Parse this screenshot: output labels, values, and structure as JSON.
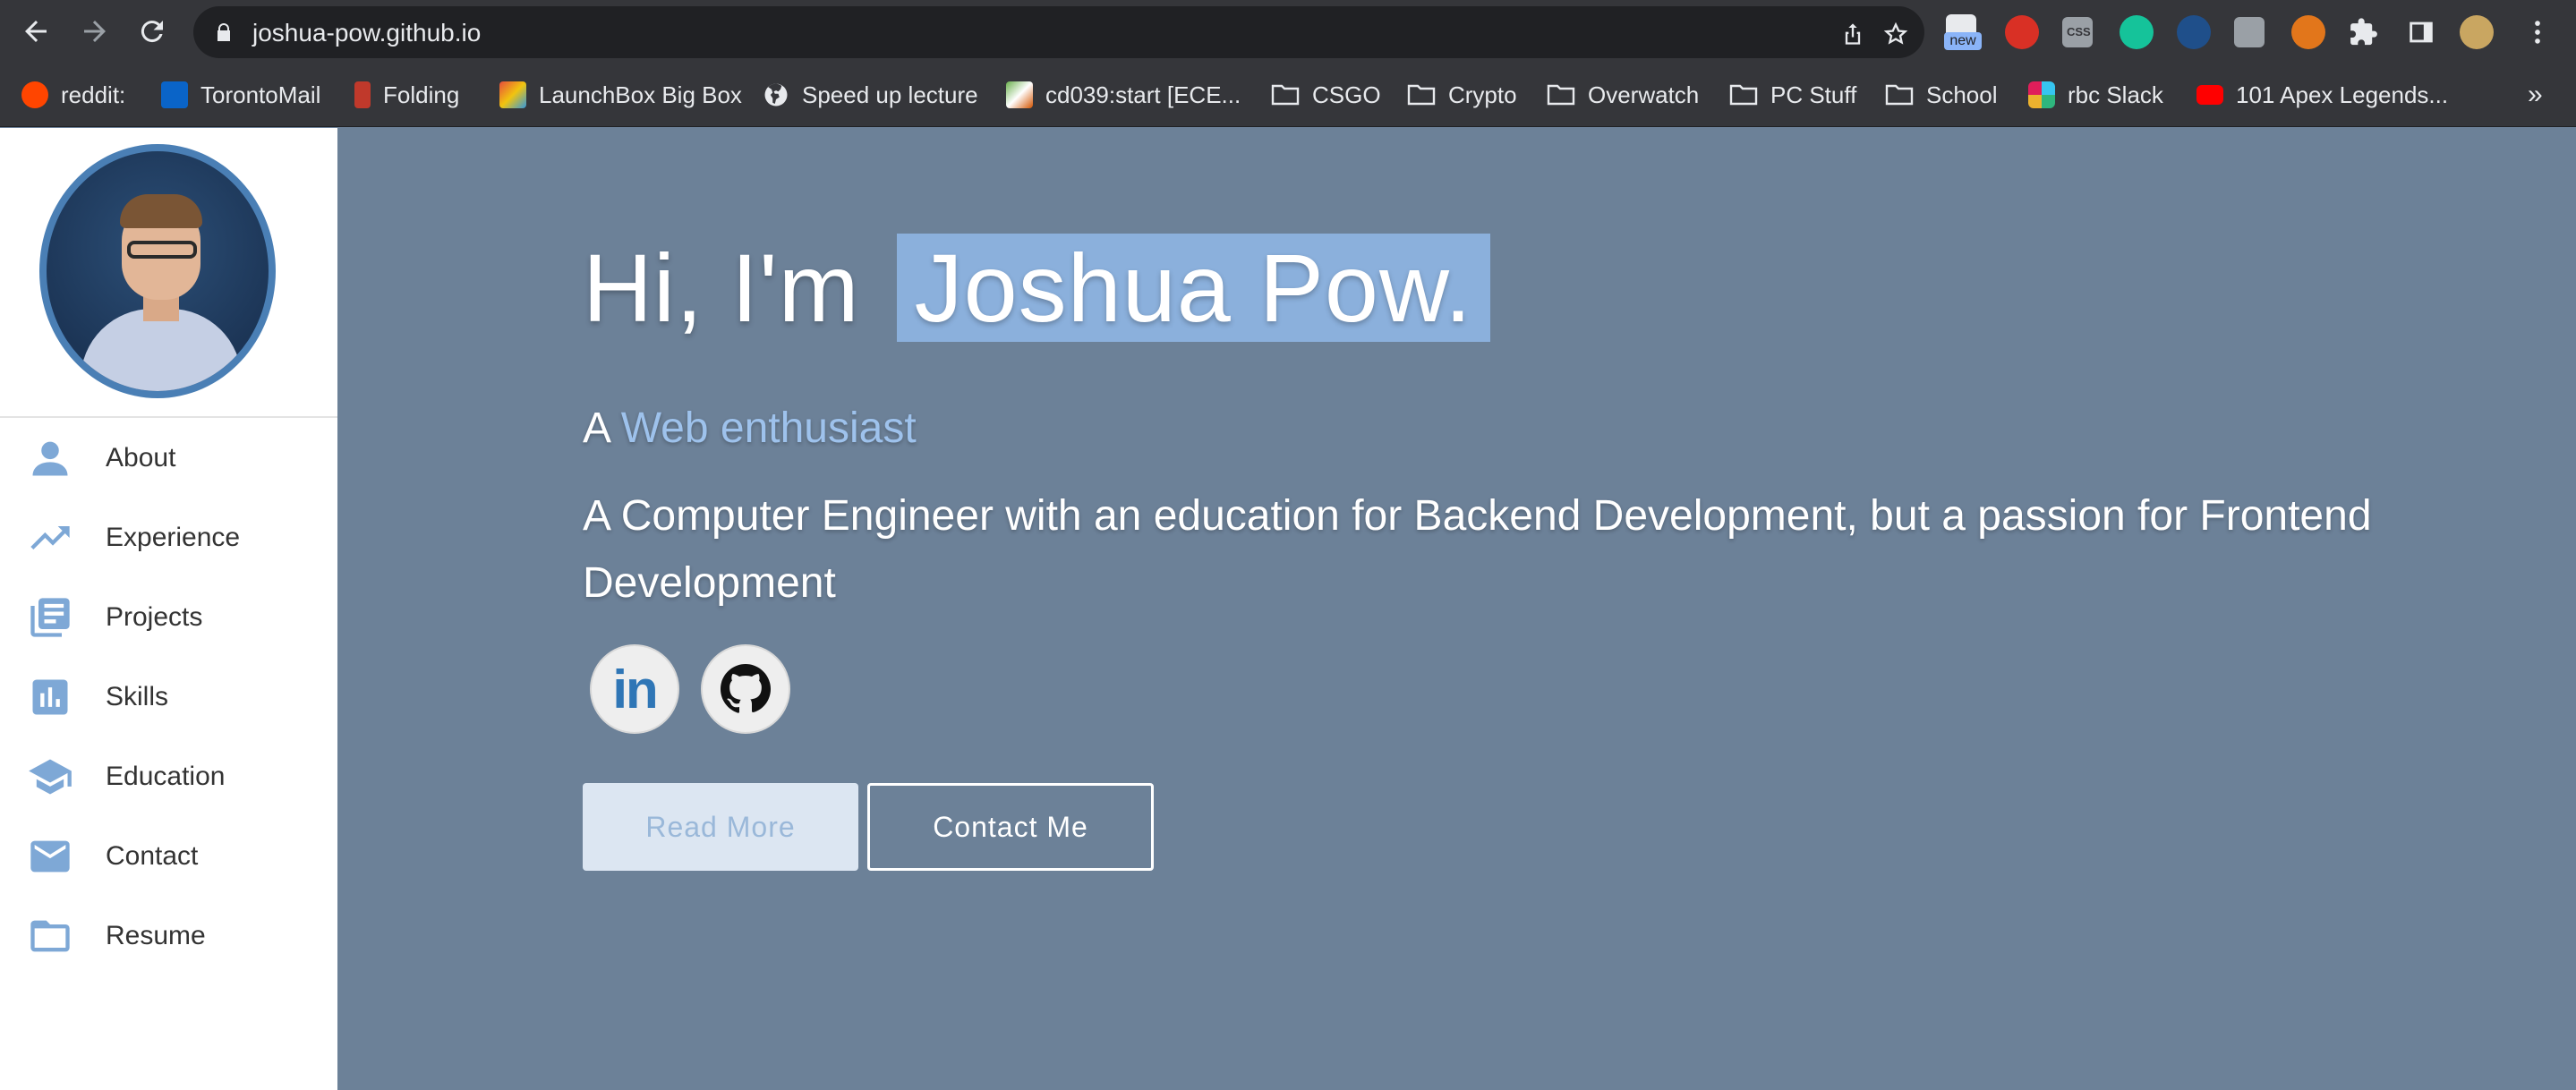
{
  "browser": {
    "url": "joshua-pow.github.io",
    "bookmarks": [
      {
        "label": "reddit:",
        "icon": "reddit-icon"
      },
      {
        "label": "TorontoMail",
        "icon": "outlook-icon"
      },
      {
        "label": "Folding",
        "icon": "folding-icon"
      },
      {
        "label": "LaunchBox Big Box",
        "icon": "launchbox-icon"
      },
      {
        "label": "Speed up lecture",
        "icon": "globe-icon"
      },
      {
        "label": "cd039:start [ECE...",
        "icon": "wiki-icon"
      },
      {
        "label": "CSGO",
        "icon": "folder-icon"
      },
      {
        "label": "Crypto",
        "icon": "folder-icon"
      },
      {
        "label": "Overwatch",
        "icon": "folder-icon"
      },
      {
        "label": "PC Stuff",
        "icon": "folder-icon"
      },
      {
        "label": "School",
        "icon": "folder-icon"
      },
      {
        "label": "rbc Slack",
        "icon": "slack-icon"
      },
      {
        "label": "101 Apex Legends...",
        "icon": "youtube-icon"
      }
    ],
    "overflow": "»",
    "badge_new": "new",
    "ext_css_label": "CSS"
  },
  "sidebar": {
    "items": [
      {
        "label": "About",
        "icon": "person-icon"
      },
      {
        "label": "Experience",
        "icon": "trending-up-icon"
      },
      {
        "label": "Projects",
        "icon": "library-books-icon"
      },
      {
        "label": "Skills",
        "icon": "bar-chart-icon"
      },
      {
        "label": "Education",
        "icon": "school-icon"
      },
      {
        "label": "Contact",
        "icon": "email-icon"
      },
      {
        "label": "Resume",
        "icon": "folder-icon"
      }
    ]
  },
  "hero": {
    "greeting": "Hi, I'm",
    "name": "Joshua Pow.",
    "role_prefix": "A",
    "role": "Web enthusiast",
    "description": "A Computer Engineer with an education for Backend Development, but a passion for Frontend Development",
    "linkedin_label": "in",
    "read_more": "Read More",
    "contact": "Contact Me"
  },
  "colors": {
    "hero_bg": "#6c8198",
    "accent": "#8bb0dc",
    "icon_blue": "#7ea8d6"
  }
}
